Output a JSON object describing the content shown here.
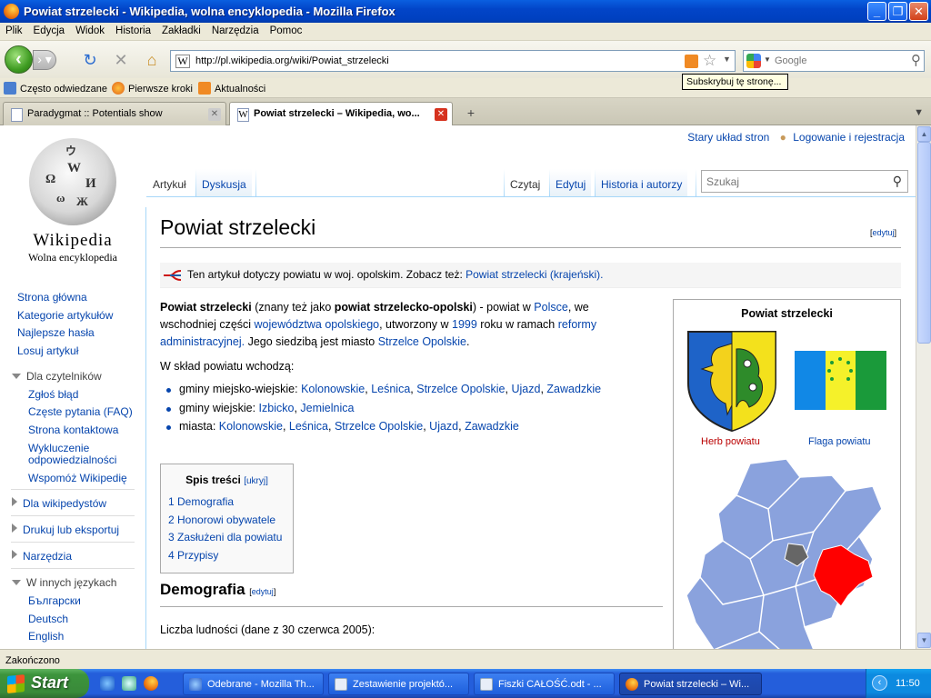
{
  "window": {
    "title": "Powiat strzelecki - Wikipedia, wolna encyklopedia - Mozilla Firefox"
  },
  "menu": [
    "Plik",
    "Edycja",
    "Widok",
    "Historia",
    "Zakładki",
    "Narzędzia",
    "Pomoc"
  ],
  "nav": {
    "url": "http://pl.wikipedia.org/wiki/Powiat_strzelecki",
    "search_placeholder": "Google"
  },
  "bookmarks": [
    "Często odwiedzane",
    "Pierwsze kroki",
    "Aktualności"
  ],
  "tooltip": "Subskrybuj tę stronę...",
  "tabs": [
    {
      "label": "Paradygmat :: Potentials show"
    },
    {
      "label": "Powiat strzelecki – Wikipedia, wo..."
    }
  ],
  "wiki": {
    "top_links": [
      "Stary układ stron",
      "Logowanie i rejestracja"
    ],
    "logo_title": "Wikipedia",
    "logo_subtitle": "Wolna encyklopedia",
    "page_tabs_left": [
      "Artykuł",
      "Dyskusja"
    ],
    "page_tabs_right": [
      "Czytaj",
      "Edytuj",
      "Historia i autorzy"
    ],
    "search_placeholder": "Szukaj",
    "sidebar": {
      "main": [
        "Strona główna",
        "Kategorie artykułów",
        "Najlepsze hasła",
        "Losuj artykuł"
      ],
      "readers_header": "Dla czytelników",
      "readers": [
        "Zgłoś błąd",
        "Częste pytania (FAQ)",
        "Strona kontaktowa",
        "Wykluczenie",
        "odpowiedzialności",
        "Wspomóż Wikipedię"
      ],
      "collapsed": [
        "Dla wikipedystów",
        "Drukuj lub eksportuj",
        "Narzędzia"
      ],
      "langs_header": "W innych językach",
      "langs": [
        "Български",
        "Deutsch",
        "English"
      ]
    },
    "title": "Powiat strzelecki",
    "edit": "[edytuj]",
    "hatnote": {
      "text": "Ten artykuł dotyczy powiatu w woj. opolskim. Zobacz też: ",
      "link": "Powiat strzelecki (krajeński)."
    },
    "intro": {
      "p1": "Powiat strzelecki",
      "p2": " (znany też jako ",
      "p3": "powiat strzelecko-opolski",
      "p4": ") - powiat w ",
      "p5": "Polsce",
      "p6": ", we",
      "p7": "wschodniej części ",
      "p8": "województwa opolskiego",
      "p9": ", utworzony w ",
      "p10": "1999",
      "p11": " roku w ramach ",
      "p12": "reformy",
      "p13": "administracyjnej.",
      "p14": " Jego siedzibą jest miasto ",
      "p15": "Strzelce Opolskie",
      "p16": "."
    },
    "consists": "W skład powiatu wchodzą:",
    "bullets": {
      "urban_rural_label": "gminy miejsko-wiejskie: ",
      "urban_rural": [
        "Kolonowskie",
        "Leśnica",
        "Strzelce Opolskie",
        "Ujazd",
        "Zawadzkie"
      ],
      "rural_label": "gminy wiejskie: ",
      "rural": [
        "Izbicko",
        "Jemielnica"
      ],
      "towns_label": "miasta: ",
      "towns": [
        "Kolonowskie",
        "Leśnica",
        "Strzelce Opolskie",
        "Ujazd",
        "Zawadzkie"
      ]
    },
    "toc": {
      "title": "Spis treści",
      "toggle": "[ukryj]",
      "items": [
        "1 Demografia",
        "2 Honorowi obywatele",
        "3 Zasłużeni dla powiatu",
        "4 Przypisy"
      ]
    },
    "section1": "Demografia",
    "population_line": "Liczba ludności (dane z 30 czerwca 2005):",
    "infobox": {
      "title": "Powiat strzelecki",
      "coat_caption": "Herb powiatu",
      "flag_caption": "Flaga powiatu"
    }
  },
  "status": "Zakończono",
  "taskbar": {
    "start": "Start",
    "tasks": [
      "Odebrane - Mozilla Th...",
      "Zestawienie projektó...",
      "Fiszki CAŁOŚĆ.odt - ...",
      "Powiat strzelecki – Wi..."
    ],
    "clock": "11:50"
  }
}
